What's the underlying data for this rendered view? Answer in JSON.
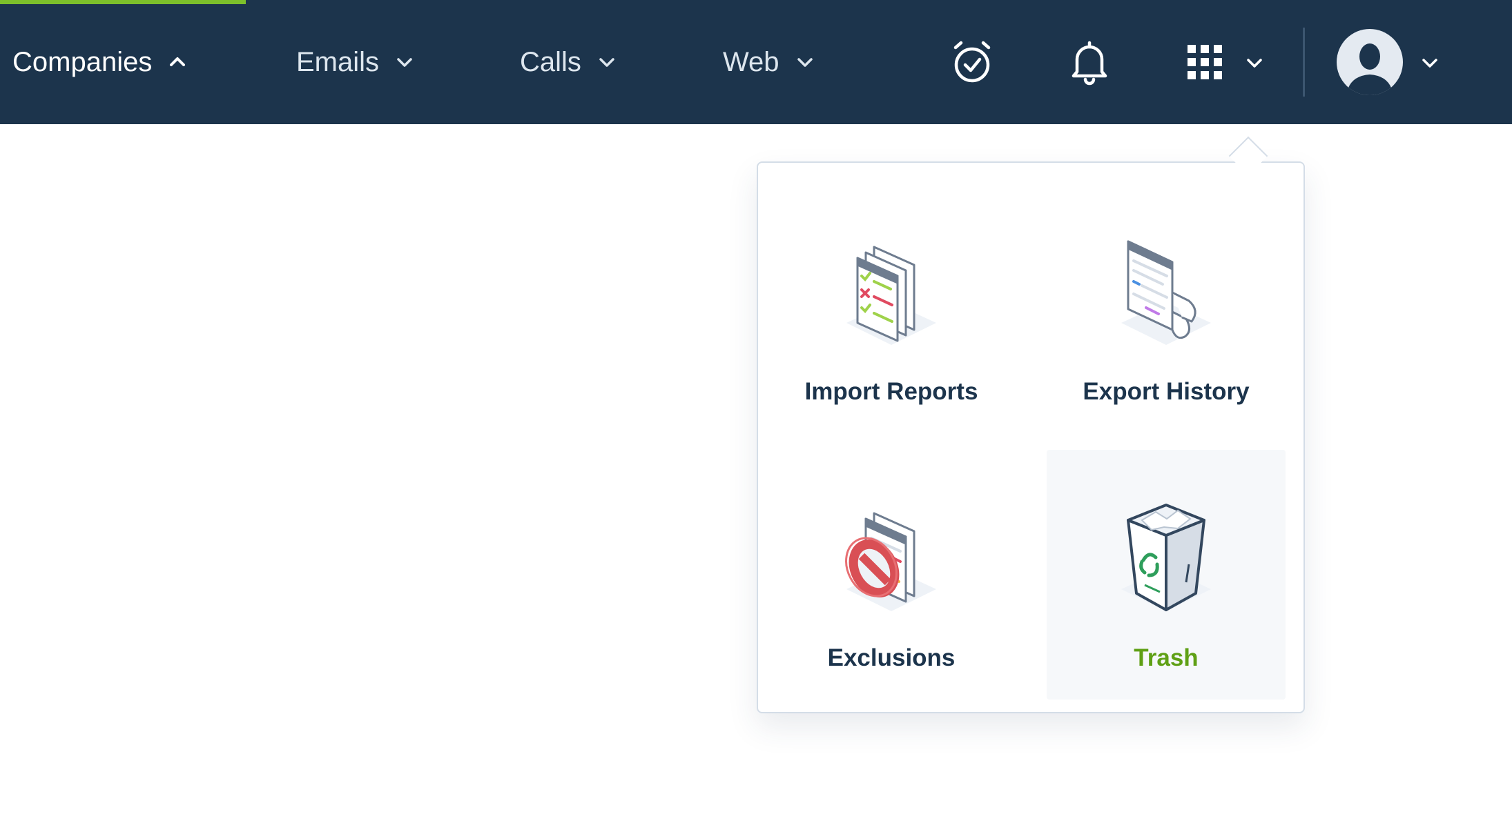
{
  "topbar": {
    "accent_color": "#7cc02b",
    "background_color": "#1c344c",
    "nav": [
      {
        "label": "Companies",
        "chevron": "up"
      },
      {
        "label": "Emails",
        "chevron": "down"
      },
      {
        "label": "Calls",
        "chevron": "down"
      },
      {
        "label": "Web",
        "chevron": "down"
      }
    ],
    "icons": [
      "alarm-check-icon",
      "bell-icon",
      "apps-grid-icon",
      "chevron-down-icon",
      "user-avatar",
      "chevron-down-icon"
    ]
  },
  "dropdown": {
    "items": [
      {
        "label": "Import Reports",
        "icon": "import-reports-icon"
      },
      {
        "label": "Export History",
        "icon": "export-history-icon"
      },
      {
        "label": "Exclusions",
        "icon": "exclusions-icon"
      },
      {
        "label": "Trash",
        "icon": "trash-icon",
        "highlighted": true
      }
    ],
    "highlight_color": "#5fa015"
  }
}
